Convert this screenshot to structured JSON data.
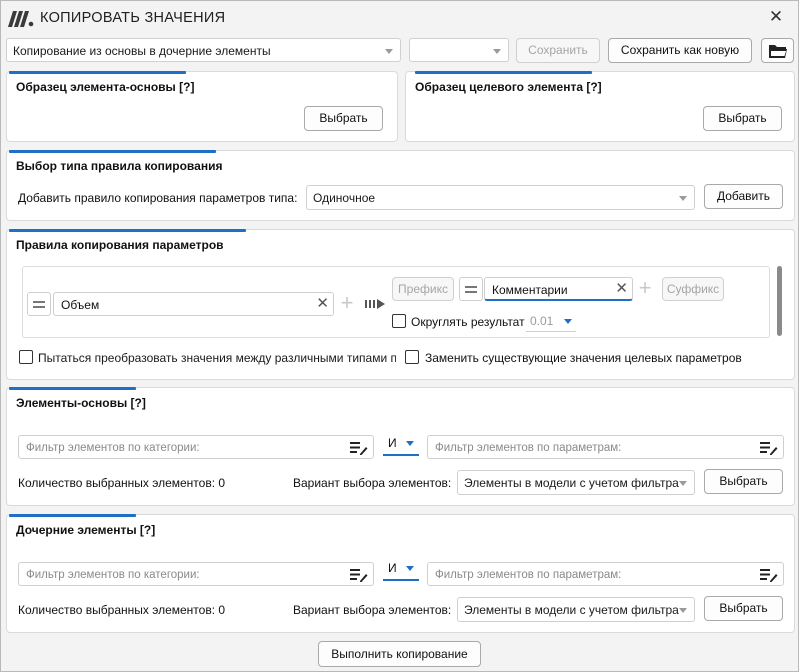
{
  "window": {
    "title": "КОПИРОВАТЬ ЗНАЧЕНИЯ",
    "close_icon": "close-icon",
    "logo_icon": "app-logo-icon"
  },
  "toolbar": {
    "preset_value": "Копирование из основы в дочерние элементы",
    "second_combo_value": "",
    "save_label": "Сохранить",
    "save_as_new_label": "Сохранить как новую",
    "folder_icon": "folder-open-icon"
  },
  "source_sample": {
    "title": "Образец элемента-основы [?]",
    "select_label": "Выбрать"
  },
  "target_sample": {
    "title": "Образец целевого элемента [?]",
    "select_label": "Выбрать"
  },
  "rule_type": {
    "title": "Выбор типа правила копирования",
    "add_label": "Добавить правило копирования параметров типа:",
    "type_value": "Одиночное",
    "add_button": "Добавить"
  },
  "rules": {
    "title": "Правила копирования параметров",
    "items": [
      {
        "source_param": "Объем",
        "prefix_label": "Префикс",
        "target_param": "Комментарии",
        "suffix_label": "Суффикс",
        "round_label": "Округлять результат",
        "round_value": "0.01"
      }
    ],
    "convert_types_label": "Пытаться преобразовать значения между различными типами п",
    "replace_existing_label": "Заменить существующие значения целевых параметров"
  },
  "base_elements": {
    "title": "Элементы-основы [?]",
    "category_filter_placeholder": "Фильтр элементов по категории:",
    "logic_value": "И",
    "param_filter_placeholder": "Фильтр элементов по параметрам:",
    "count_label": "Количество выбранных элементов: 0",
    "variant_label": "Вариант выбора элементов:",
    "variant_value": "Элементы в модели с учетом фильтра",
    "select_label": "Выбрать"
  },
  "child_elements": {
    "title": "Дочерние элементы [?]",
    "category_filter_placeholder": "Фильтр элементов по категории:",
    "logic_value": "И",
    "param_filter_placeholder": "Фильтр элементов по параметрам:",
    "count_label": "Количество выбранных элементов: 0",
    "variant_label": "Вариант выбора элементов:",
    "variant_value": "Элементы в модели с учетом фильтра",
    "select_label": "Выбрать"
  },
  "footer": {
    "execute_label": "Выполнить копирование"
  },
  "colors": {
    "accent": "#1f6fc5",
    "logo": "#3a3a3a"
  }
}
